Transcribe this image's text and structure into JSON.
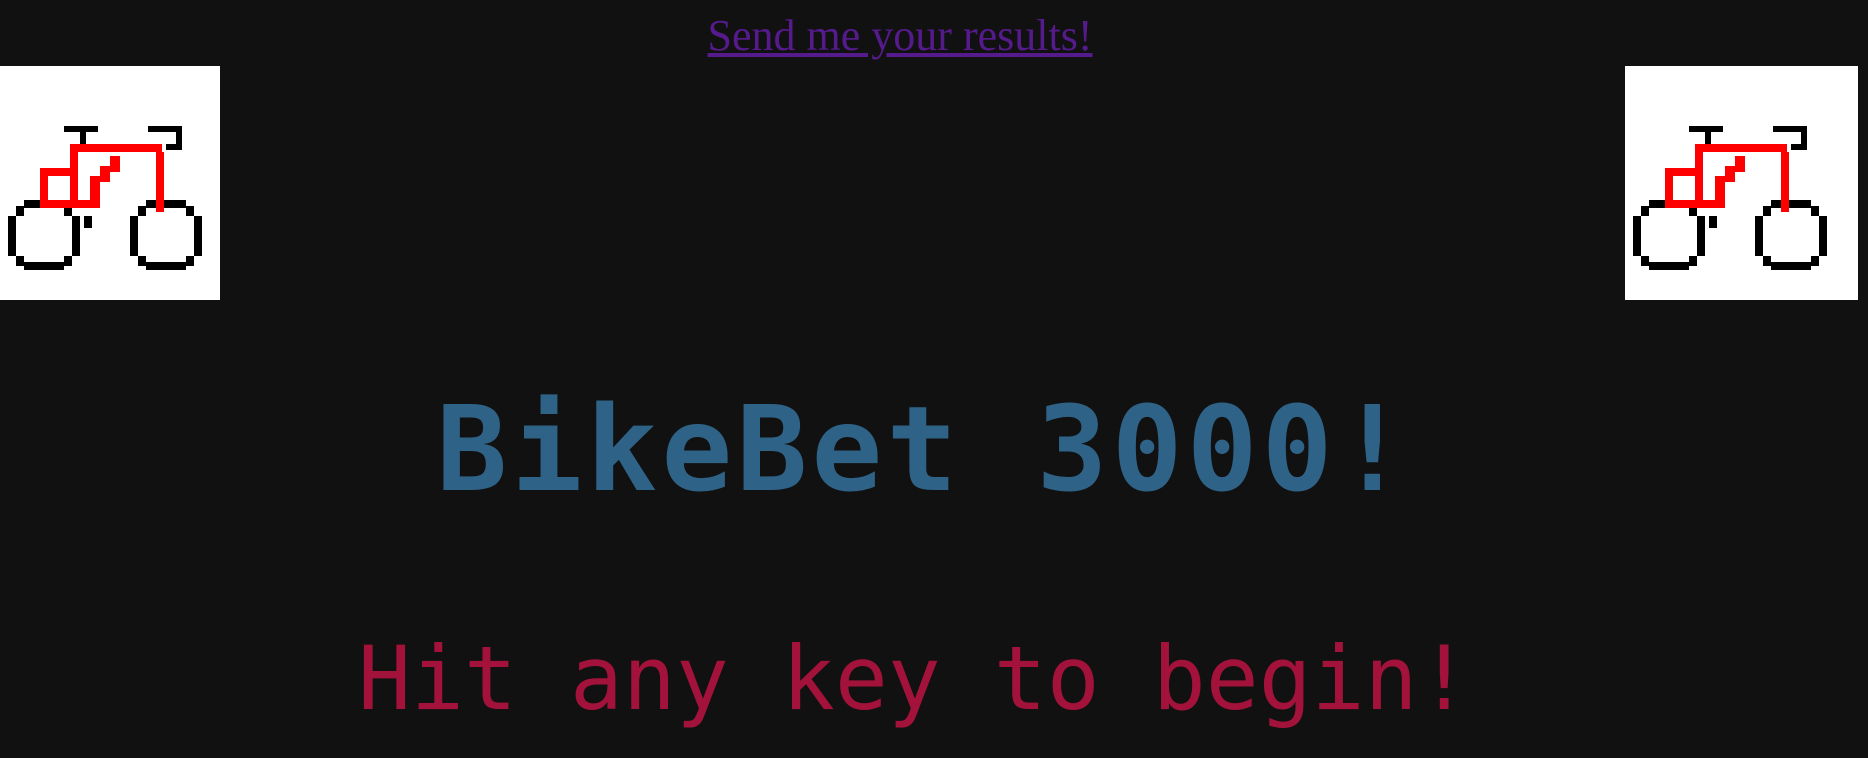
{
  "link": {
    "text": "Send me your results!",
    "color": "#551a8b"
  },
  "title": {
    "text": "BikeBet 3000!",
    "color": "#2e6286"
  },
  "prompt": {
    "text": "Hit any key to begin!",
    "color": "#a3123a"
  },
  "bike_images": [
    {
      "name": "bike-left",
      "icon": "pixel-bicycle-icon"
    },
    {
      "name": "bike-right",
      "icon": "pixel-bicycle-icon"
    }
  ],
  "colors": {
    "background": "#111111",
    "bike_frame": "#ff0000",
    "bike_wheels": "#000000"
  }
}
